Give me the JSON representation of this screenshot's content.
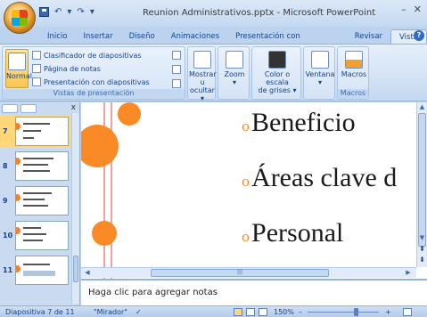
{
  "window": {
    "title": "Reunion Administrativos.pptx - Microsoft PowerPoint",
    "minimize": "–",
    "close": "✕"
  },
  "quick_access": {
    "undo": "↶",
    "redo": "↷",
    "customize": "▾"
  },
  "tabs": [
    {
      "label": "Inicio"
    },
    {
      "label": "Insertar"
    },
    {
      "label": "Diseño"
    },
    {
      "label": "Animaciones"
    },
    {
      "label": "Presentación con diapositivas"
    },
    {
      "label": "Revisar"
    },
    {
      "label": "Vista"
    }
  ],
  "help": "?",
  "ribbon": {
    "presentation_views": {
      "normal": "Normal",
      "slide_sorter": "Clasificador de diapositivas",
      "notes_page": "Página de notas",
      "slide_show": "Presentación con diapositivas",
      "group_label": "Vistas de presentación"
    },
    "show_hide": {
      "label_line1": "Mostrar u",
      "label_line2": "ocultar ▾"
    },
    "zoom": {
      "label": "Zoom",
      "arrow": "▾"
    },
    "color": {
      "label_line1": "Color o escala",
      "label_line2": "de grises ▾"
    },
    "window": {
      "label": "Ventana",
      "arrow": "▾"
    },
    "macros": {
      "label": "Macros",
      "group_label": "Macros"
    }
  },
  "slides_pane": {
    "close": "x",
    "thumbnails": [
      {
        "number": "7",
        "selected": true
      },
      {
        "number": "8",
        "selected": false
      },
      {
        "number": "9",
        "selected": false
      },
      {
        "number": "10",
        "selected": false
      },
      {
        "number": "11",
        "selected": false
      }
    ]
  },
  "slide": {
    "bullets": [
      {
        "marker": "o",
        "text": "Beneficio"
      },
      {
        "marker": "o",
        "text": "Áreas clave d"
      },
      {
        "marker": "o",
        "text": "Personal"
      }
    ],
    "accent_color": "#f98a26",
    "line_color": "#f2a0a0"
  },
  "scroll": {
    "up": "▲",
    "down": "▼",
    "prev_slide": "⇞",
    "next_slide": "⇟",
    "left": "◀",
    "right": "▶",
    "grip": "|||"
  },
  "notes": {
    "placeholder": "Haga clic para agregar notas"
  },
  "status": {
    "slide_indicator": "Diapositiva 7 de 11",
    "theme": "\"Mirador\"",
    "spell_check": "✓",
    "zoom_level": "150%",
    "zoom_out": "–",
    "zoom_in": "+"
  }
}
